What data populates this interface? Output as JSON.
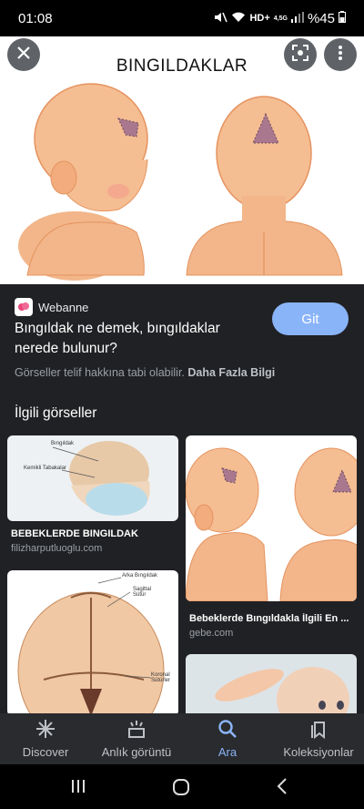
{
  "status": {
    "time": "01:08",
    "net": "HD+",
    "net_sub": "4,5G",
    "battery": "%45"
  },
  "hero": {
    "title": "BINGILDAKLAR"
  },
  "source": {
    "name": "Webanne"
  },
  "page": {
    "title": "Bıngıldak ne demek, bıngıldaklar nerede bulunur?",
    "visit_label": "Git"
  },
  "copyright": {
    "text": "Görseller telif hakkına tabi olabilir.",
    "link": "Daha Fazla Bilgi"
  },
  "related": {
    "title": "İlgili görseller",
    "cards": [
      {
        "title": "BEBEKLERDE BINGILDAK",
        "source": "filizharputluoglu.com",
        "labels": [
          "Bıngıldak",
          "Kemikli Tabakalar"
        ]
      },
      {
        "title": "Bebeklerde Bıngıldakla İlgili En ...",
        "source": "gebe.com"
      },
      {
        "labels": [
          "Arka Bıngıldak",
          "Sagittal Sütür",
          "Koronal Sütürler"
        ]
      }
    ]
  },
  "nav": {
    "items": [
      {
        "label": "Discover"
      },
      {
        "label": "Anlık görüntü"
      },
      {
        "label": "Ara"
      },
      {
        "label": "Koleksiyonlar"
      }
    ]
  },
  "colors": {
    "accent": "#8ab4f8",
    "background": "#202124",
    "skin": "#f2b68a"
  }
}
